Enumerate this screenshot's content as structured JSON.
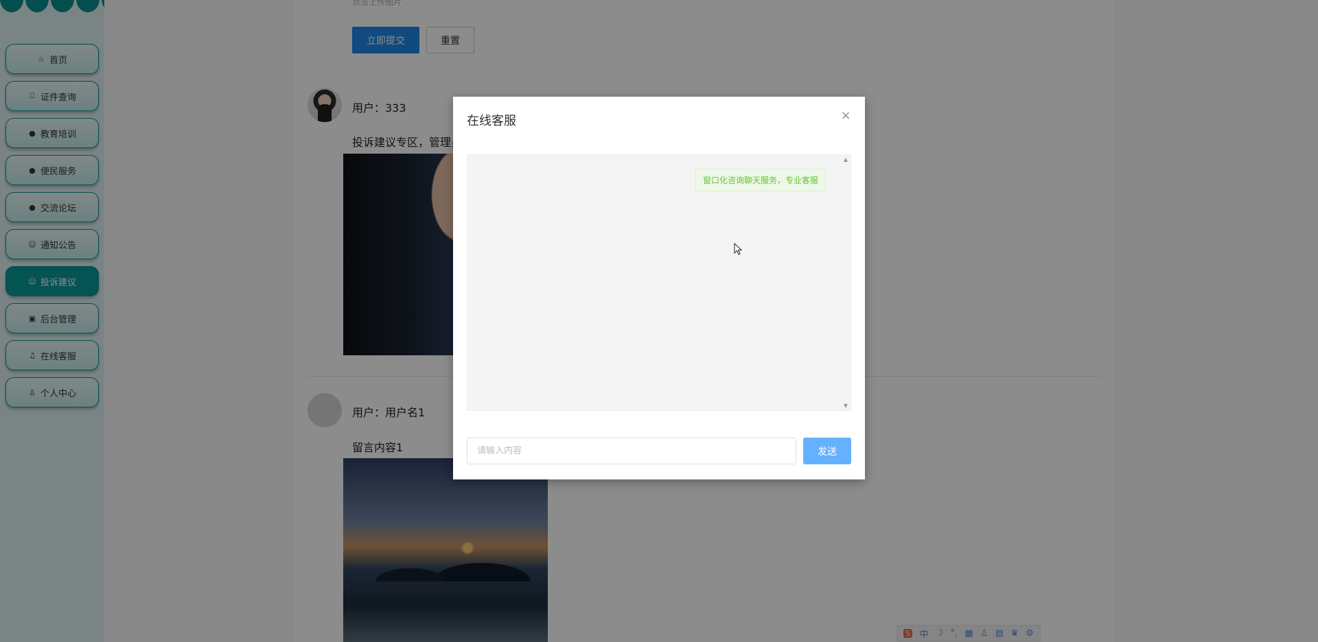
{
  "sidebar": {
    "items": [
      {
        "label": "首页",
        "icon": "☆",
        "icon_name": "star-icon",
        "active": false
      },
      {
        "label": "证件查询",
        "icon": "⎕",
        "icon_name": "bag-icon",
        "active": false
      },
      {
        "label": "教育培训",
        "icon": "●",
        "icon_name": "info-circle-icon",
        "active": false
      },
      {
        "label": "便民服务",
        "icon": "●",
        "icon_name": "question-circle-icon",
        "active": false
      },
      {
        "label": "交流论坛",
        "icon": "●",
        "icon_name": "info-filled-icon",
        "active": false
      },
      {
        "label": "通知公告",
        "icon": "☺",
        "icon_name": "smile-icon",
        "active": false
      },
      {
        "label": "投诉建议",
        "icon": "☺",
        "icon_name": "comment-icon",
        "active": true
      },
      {
        "label": "后台管理",
        "icon": "▣",
        "icon_name": "box-icon",
        "active": false
      },
      {
        "label": "在线客服",
        "icon": "♫",
        "icon_name": "headset-icon",
        "active": false
      },
      {
        "label": "个人中心",
        "icon": "♙",
        "icon_name": "user-icon",
        "active": false
      }
    ]
  },
  "form": {
    "hint": "点击上传图片",
    "submit_label": "立即提交",
    "reset_label": "重置"
  },
  "posts": [
    {
      "user": "用户：333",
      "text": "投诉建议专区，管理员"
    },
    {
      "user": "用户：用户名1",
      "text": "留言内容1"
    }
  ],
  "dialog": {
    "title": "在线客服",
    "close_icon": "×",
    "message": "窗口化咨询聊天服务，专业客服",
    "input_placeholder": "请输入内容",
    "send_label": "发送"
  },
  "ime": {
    "items": [
      "S",
      "中",
      "☽",
      "°,",
      "▦",
      "♙",
      "▤",
      "♛",
      "⚙"
    ]
  },
  "colors": {
    "accent": "#0a9a9a",
    "primary": "#1e88e5",
    "send": "#66b1ff",
    "message_text": "#67c23a"
  }
}
